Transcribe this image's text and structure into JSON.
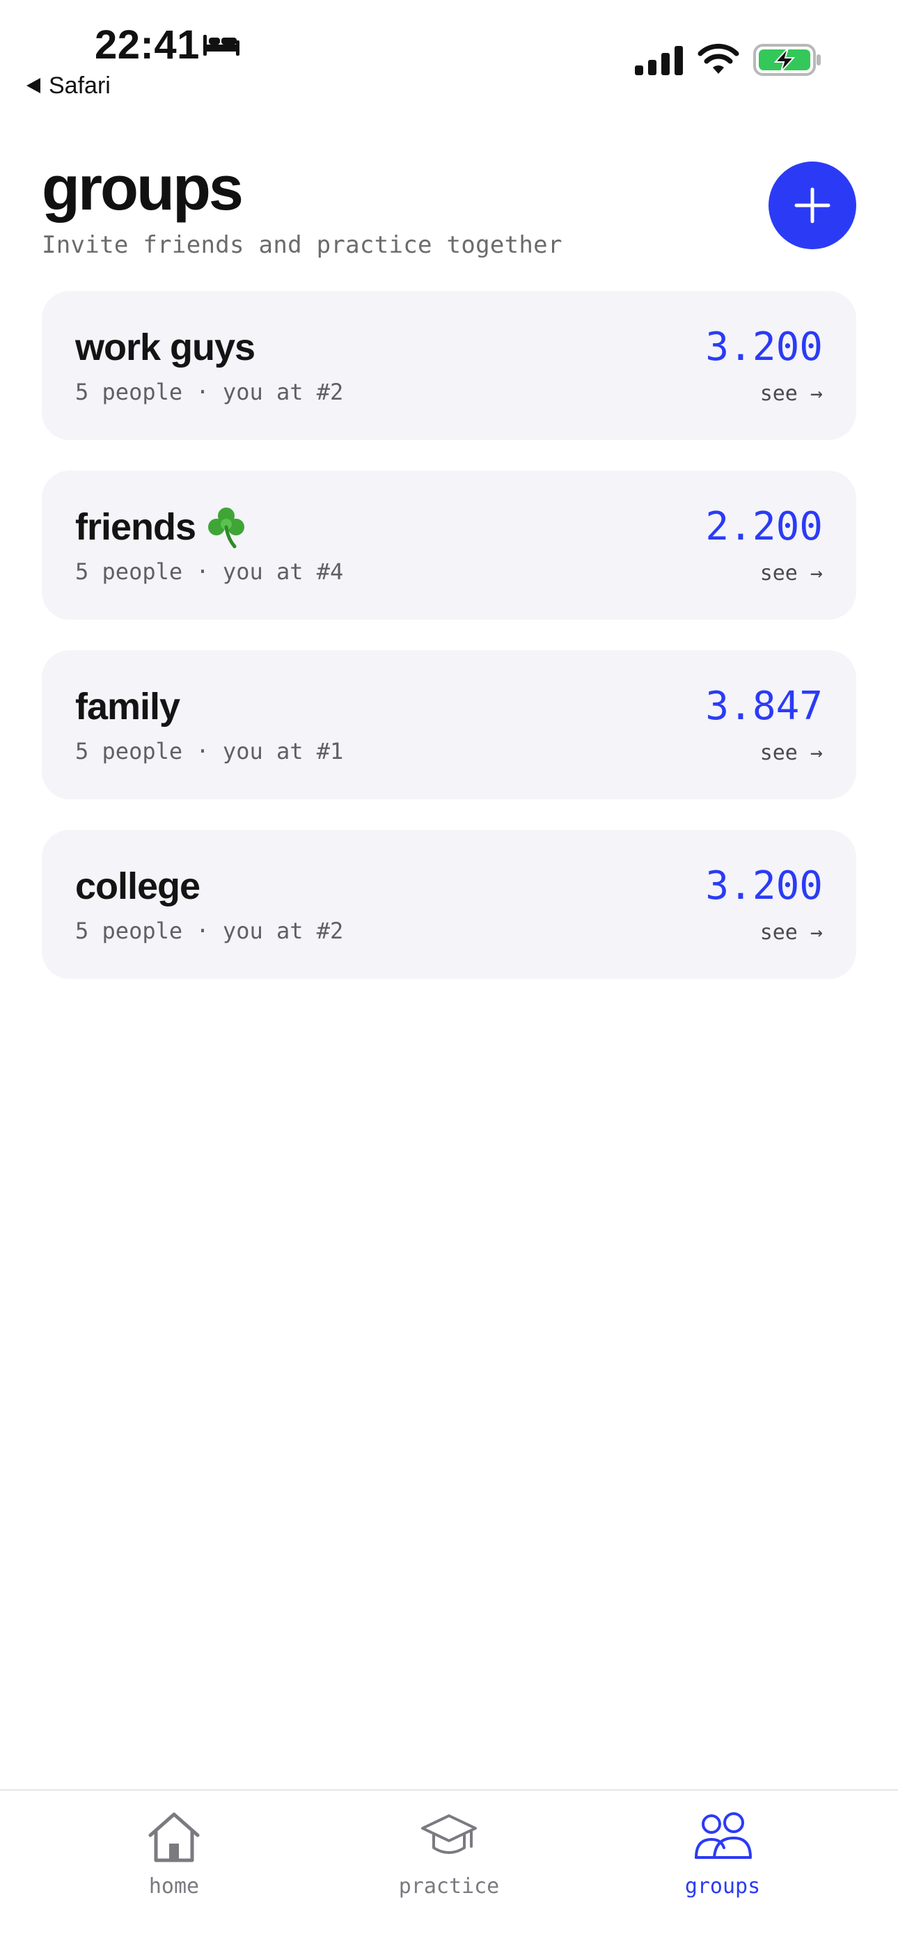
{
  "status_bar": {
    "time": "22:41",
    "back_label": "Safari"
  },
  "header": {
    "title": "groups",
    "subtitle": "Invite friends and practice together"
  },
  "groups": [
    {
      "name": "work guys",
      "emoji": "",
      "meta": "5 people · you at #2",
      "score": "3.200",
      "see": "see →"
    },
    {
      "name": "friends",
      "emoji": "☘",
      "meta": "5 people · you at #4",
      "score": "2.200",
      "see": "see →"
    },
    {
      "name": "family",
      "emoji": "",
      "meta": "5 people · you at #1",
      "score": "3.847",
      "see": "see →"
    },
    {
      "name": "college",
      "emoji": "",
      "meta": "5 people · you at #2",
      "score": "3.200",
      "see": "see →"
    }
  ],
  "tabs": [
    {
      "label": "home",
      "icon": "house-icon",
      "active": false
    },
    {
      "label": "practice",
      "icon": "graduation-cap-icon",
      "active": false
    },
    {
      "label": "groups",
      "icon": "people-icon",
      "active": true
    }
  ],
  "colors": {
    "accent": "#2b3bf5",
    "card_background": "#f4f4f9",
    "muted_text": "#6b6b6b",
    "battery_green": "#34c759"
  }
}
